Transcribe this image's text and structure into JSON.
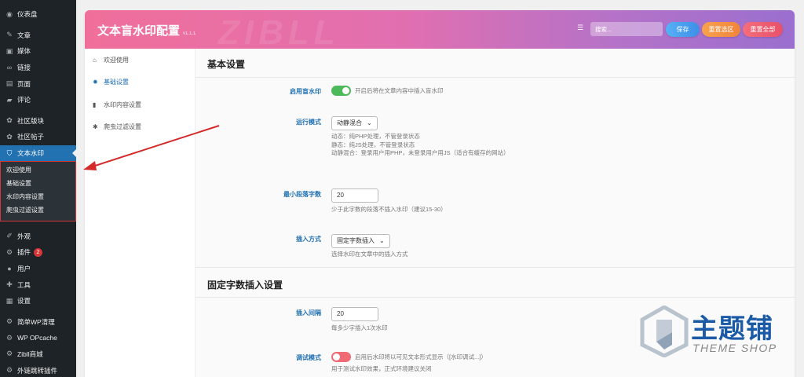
{
  "wp_menu": {
    "items_top": [
      {
        "icon": "dashboard-icon",
        "glyph": "◉",
        "label": "仪表盘"
      }
    ],
    "items_mid": [
      {
        "icon": "pin-icon",
        "glyph": "✎",
        "label": "文章"
      },
      {
        "icon": "media-icon",
        "glyph": "▣",
        "label": "媒体"
      },
      {
        "icon": "link-icon",
        "glyph": "∞",
        "label": "链接"
      },
      {
        "icon": "page-icon",
        "glyph": "▤",
        "label": "页面"
      },
      {
        "icon": "comment-icon",
        "glyph": "▰",
        "label": "评论"
      }
    ],
    "items_community": [
      {
        "icon": "forum-icon",
        "glyph": "✿",
        "label": "社区版块"
      },
      {
        "icon": "post-icon",
        "glyph": "✿",
        "label": "社区帖子"
      }
    ],
    "active": {
      "icon": "shield-icon",
      "glyph": "⛉",
      "label": "文本水印"
    },
    "submenu": [
      "欢迎使用",
      "基础设置",
      "水印内容设置",
      "爬虫过滤设置"
    ],
    "items_bottom": [
      {
        "icon": "appearance-icon",
        "glyph": "✐",
        "label": "外观"
      },
      {
        "icon": "plugin-icon",
        "glyph": "⚙",
        "label": "插件",
        "badge": "2"
      },
      {
        "icon": "user-icon",
        "glyph": "●",
        "label": "用户"
      },
      {
        "icon": "tool-icon",
        "glyph": "✚",
        "label": "工具"
      },
      {
        "icon": "settings-icon",
        "glyph": "▦",
        "label": "设置"
      }
    ],
    "items_plugins": [
      {
        "icon": "gear-icon",
        "glyph": "⚙",
        "label": "简单WP清理"
      },
      {
        "icon": "gear-icon",
        "glyph": "⚙",
        "label": "WP OPcache"
      },
      {
        "icon": "shop-icon",
        "glyph": "⚙",
        "label": "Zibll商城"
      },
      {
        "icon": "gear-icon",
        "glyph": "⚙",
        "label": "外链跳转插件"
      }
    ]
  },
  "header": {
    "title": "文本盲水印配置",
    "version": "v1.1.1",
    "watermark_text": "ZIBLL",
    "search_placeholder": "搜索...",
    "save": "保存",
    "reset_selected": "重置选区",
    "reset_all": "重置全部"
  },
  "settings_nav": [
    {
      "icon": "home-icon",
      "glyph": "⌂",
      "label": "欢迎使用"
    },
    {
      "icon": "gear-icon",
      "glyph": "✹",
      "label": "基础设置",
      "active": true
    },
    {
      "icon": "file-icon",
      "glyph": "▮",
      "label": "水印内容设置"
    },
    {
      "icon": "bug-icon",
      "glyph": "✱",
      "label": "爬虫过滤设置"
    }
  ],
  "section_basic": {
    "title": "基本设置",
    "enable": {
      "label": "启用盲水印",
      "state": "on",
      "desc": "开启后将在文章内容中插入盲水印"
    },
    "mode": {
      "label": "运行模式",
      "value": "动静混合",
      "help": [
        "动态：纯PHP处理，不管登录状态",
        "静态：纯JS处理，不管登录状态",
        "动静混合：登录用户用PHP，未登录用户用JS（适合有缓存的网站）"
      ]
    },
    "min_len": {
      "label": "最小段落字数",
      "value": "20",
      "help": "少于此字数的段落不插入水印（建议15-30）"
    },
    "insert_method": {
      "label": "插入方式",
      "value": "固定字数插入",
      "help": "选择水印在文章中的插入方式"
    }
  },
  "section_fixed": {
    "title": "固定字数插入设置",
    "interval": {
      "label": "插入间隔",
      "value": "20",
      "help": "每多少字插入1次水印"
    },
    "debug": {
      "label": "调试模式",
      "state": "off",
      "desc": "启用后水印将以可见文本形式显示（[水印调试...]）",
      "help": "用于测试水印效果，正式环境建议关闭"
    }
  },
  "logo": {
    "cn": "主题铺",
    "en": "THEME SHOP"
  }
}
